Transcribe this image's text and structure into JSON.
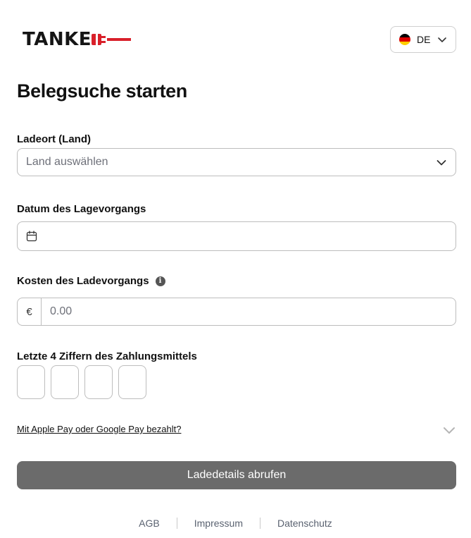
{
  "brand": {
    "logo_text": "TANKE",
    "accent_color": "#d9202a"
  },
  "language": {
    "code": "DE",
    "flag_icon": "germany-flag-icon"
  },
  "page_title": "Belegsuche starten",
  "form": {
    "country": {
      "label": "Ladeort (Land)",
      "placeholder": "Land auswählen"
    },
    "date": {
      "label": "Datum des Lagevorgangs",
      "icon": "calendar-icon"
    },
    "cost": {
      "label": "Kosten des Ladevorgangs",
      "currency": "€",
      "placeholder": "0.00",
      "info_icon": "info-icon"
    },
    "card_digits": {
      "label": "Letzte 4 Ziffern des Zahlungsmittels",
      "count": 4
    },
    "wallet_toggle": {
      "label": "Mit Apple Pay oder Google Pay bezahlt?"
    },
    "submit_label": "Ladedetails abrufen"
  },
  "footer": {
    "links": [
      "AGB",
      "Impressum",
      "Datenschutz"
    ]
  },
  "colors": {
    "button_bg": "#6b6b6b",
    "border": "#bdbdbd",
    "footer_link": "#5a6270"
  }
}
